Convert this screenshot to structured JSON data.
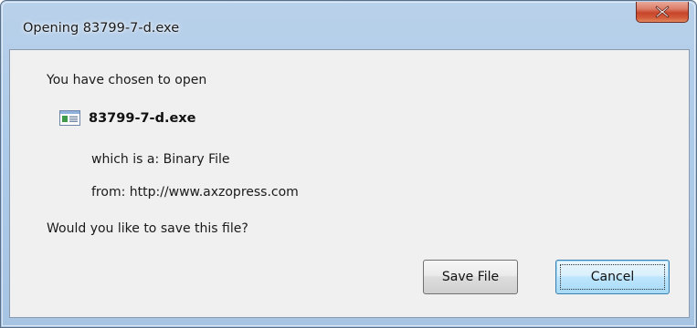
{
  "window": {
    "title": "Opening 83799-7-d.exe",
    "close_icon": "close-icon"
  },
  "dialog": {
    "intro": "You have chosen to open",
    "file": {
      "name": "83799-7-d.exe",
      "icon": "executable-file-icon"
    },
    "type_label": "which is a:",
    "type_value": "Binary File",
    "from_label": "from:",
    "from_value": "http://www.axzopress.com",
    "question": "Would you like to save this file?"
  },
  "buttons": {
    "save": "Save File",
    "cancel": "Cancel"
  },
  "colors": {
    "title_bar": "#aecbe9",
    "close_button": "#c7452b",
    "client_background": "#f0f0f0",
    "default_button_border": "#3c7fb1"
  }
}
